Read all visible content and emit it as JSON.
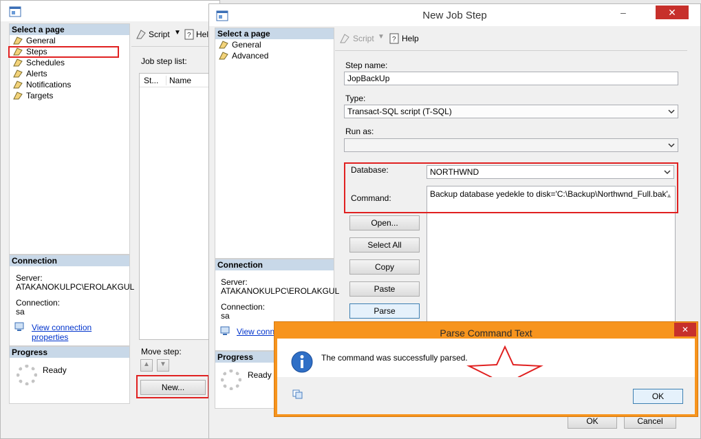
{
  "bg_window": {
    "select_page": "Select a page",
    "nav": [
      "General",
      "Steps",
      "Schedules",
      "Alerts",
      "Notifications",
      "Targets"
    ],
    "toolbar_script": "Script",
    "toolbar_help": "Help",
    "job_step_list": "Job step list:",
    "col_step": "St...",
    "col_name": "Name",
    "connection_header": "Connection",
    "server_label": "Server:",
    "server_value": "ATAKANOKULPC\\EROLAKGUL",
    "connection_label": "Connection:",
    "connection_value": "sa",
    "view_conn": "View connection properties",
    "progress_header": "Progress",
    "progress_status": "Ready",
    "move_step": "Move step:",
    "new_button": "New..."
  },
  "step_window": {
    "title": "New Job Step",
    "select_page": "Select a page",
    "nav": [
      "General",
      "Advanced"
    ],
    "toolbar_script": "Script",
    "toolbar_help": "Help",
    "step_name_label": "Step name:",
    "step_name_value": "JopBackUp",
    "type_label": "Type:",
    "type_value": "Transact-SQL script (T-SQL)",
    "run_as_label": "Run as:",
    "run_as_value": "",
    "database_label": "Database:",
    "database_value": "NORTHWND",
    "command_label": "Command:",
    "command_value": "Backup database yedekle  to disk='C:\\Backup\\Northwnd_Full.bak'",
    "buttons": [
      "Open...",
      "Select All",
      "Copy",
      "Paste",
      "Parse"
    ],
    "connection_header": "Connection",
    "server_label": "Server:",
    "server_value": "ATAKANOKULPC\\EROLAKGUL",
    "connection_label": "Connection:",
    "connection_value": "sa",
    "view_conn": "View conne",
    "progress_header": "Progress",
    "progress_status": "Ready",
    "ok": "OK",
    "cancel": "Cancel"
  },
  "parse_dialog": {
    "title": "Parse Command Text",
    "message": "The command was successfully parsed.",
    "ok": "OK"
  },
  "colors": {
    "dialog_accent": "#f7941d",
    "highlight": "#e02020"
  }
}
